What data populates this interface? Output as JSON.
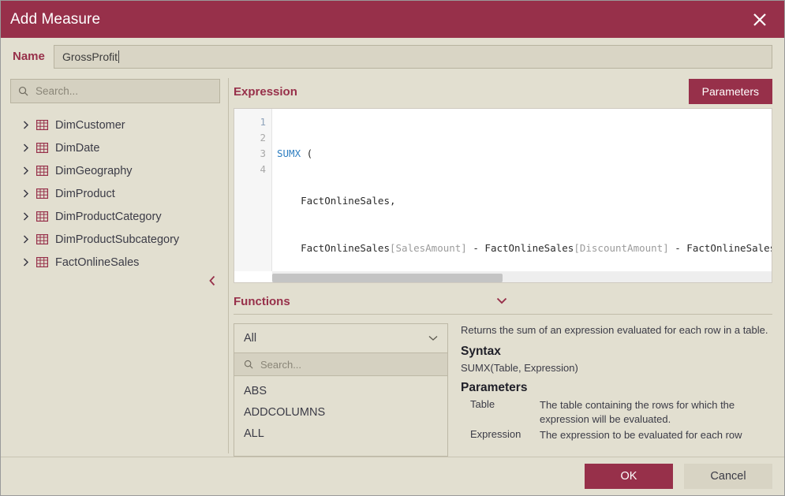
{
  "dialog": {
    "title": "Add Measure",
    "close_icon": "close-icon"
  },
  "name_field": {
    "label": "Name",
    "value": "GrossProfit",
    "placeholder": ""
  },
  "tree_panel": {
    "search": {
      "placeholder": "Search...",
      "icon": "search-icon"
    },
    "collapse_icon": "chevron-left-icon",
    "items": [
      {
        "label": "DimCustomer",
        "icon": "table-icon",
        "expand_icon": "chevron-right-icon"
      },
      {
        "label": "DimDate",
        "icon": "table-icon",
        "expand_icon": "chevron-right-icon"
      },
      {
        "label": "DimGeography",
        "icon": "table-icon",
        "expand_icon": "chevron-right-icon"
      },
      {
        "label": "DimProduct",
        "icon": "table-icon",
        "expand_icon": "chevron-right-icon"
      },
      {
        "label": "DimProductCategory",
        "icon": "table-icon",
        "expand_icon": "chevron-right-icon"
      },
      {
        "label": "DimProductSubcategory",
        "icon": "table-icon",
        "expand_icon": "chevron-right-icon"
      },
      {
        "label": "FactOnlineSales",
        "icon": "table-icon",
        "expand_icon": "chevron-right-icon"
      }
    ]
  },
  "expression": {
    "title": "Expression",
    "parameters_button": "Parameters",
    "line_numbers": [
      "1",
      "2",
      "3",
      "4"
    ],
    "code_lines": [
      "SUMX (",
      "    FactOnlineSales,",
      "    FactOnlineSales[SalesAmount] - FactOnlineSales[DiscountAmount] - FactOnlineSales[",
      "     )"
    ]
  },
  "functions": {
    "title": "Functions",
    "collapse_icon": "chevron-down-icon",
    "category_selected": "All",
    "category_chevron": "chevron-down-icon",
    "search": {
      "placeholder": "Search...",
      "icon": "search-icon"
    },
    "items": [
      "ABS",
      "ADDCOLUMNS",
      "ALL"
    ]
  },
  "documentation": {
    "description": "Returns the sum of an expression evaluated for each row in a table.",
    "syntax_heading": "Syntax",
    "syntax": "SUMX(Table, Expression)",
    "parameters_heading": "Parameters",
    "parameters": [
      {
        "name": "Table",
        "description": "The table containing the rows for which the expression will be evaluated."
      },
      {
        "name": "Expression",
        "description": "The expression to be evaluated for each row"
      }
    ]
  },
  "footer": {
    "ok": "OK",
    "cancel": "Cancel"
  }
}
